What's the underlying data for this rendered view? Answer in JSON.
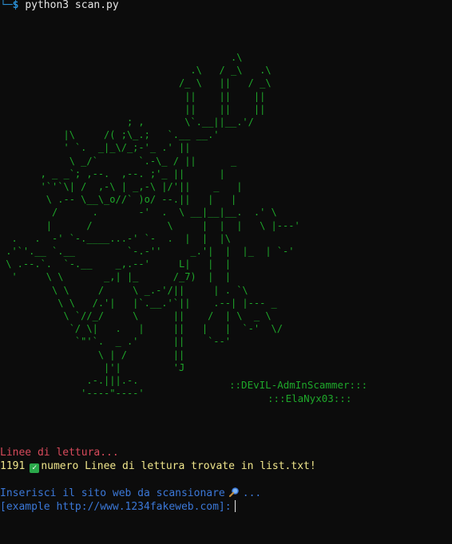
{
  "prompt": {
    "corner": "└─",
    "symbol": "$",
    "command": "python3 scan.py"
  },
  "ascii_art": "                                        .\\\n                                 .\\   / _\\   .\\\n                               /_ \\   ||   / _\\\n                                ||    ||    ||\n                                ||    ||    ||\n                      ; ,       \\`.__||__.'/\n           |\\     /( ;\\_.;   `.__ __.'\n           ' `.  _|_\\/_;-'_ .' ||\n            \\ _/`       `.-\\_ / ||      _\n       , _ _`; ,--.  ,--. ;'_ ||      |\n       '`'`\\| /  ,-\\ | _,-\\ |/'||    _   |\n        \\ .-- \\__\\_o//` )o/ --.||   |   |\n         /      .       -'  .  \\ __|__|__.  .' \\\n        |      /             \\     |  |  |   \\ |---'\n  .   .  -' `-.____...-' `-  .  |  |  |\\\n .'`'.__ `.__         `-.-''     _.'|  |  |_  | `-'\n \\ .--.`.  `-.__    _,.--'     L|   |  |\n  '     \\ \\       _,| |_      /_7)  |  |\n         \\ \\     /     \\ _.-'/||     | . `\\\n          \\ \\   /.'|   |`.__.'`||    .--| |--- _\n           \\ `//_/     \\      ||    /  | \\  _ \\\n            `/ \\|   .   |     ||   |   |  `-'  \\/\n             `\"'`.  _ .'      ||    `--'\n                 \\ | /        ||\n                  |'|         'J\n               .-.|||.-.\n              '----\"----'",
  "banner": {
    "line1": "::DEvIL-AdmInScammer:::",
    "line2": ":::ElaNyx03:::"
  },
  "output": {
    "reading": "Linee di lettura...",
    "count": "1191",
    "found_text": "numero Linee di lettura trovate in list.txt!",
    "input_prompt": "Inserisci il sito web da scansionare",
    "input_suffix": "...",
    "example": "[example http://www.1234fakeweb.com]:"
  },
  "icons": {
    "check": "check-mark-icon",
    "search": "magnifier-icon"
  },
  "colors": {
    "background": "#0c0c0c",
    "art_green": "#1ea82a",
    "error_red": "#d84a5b",
    "info_yellow": "#f0e68c",
    "prompt_blue": "#3b78d8"
  }
}
